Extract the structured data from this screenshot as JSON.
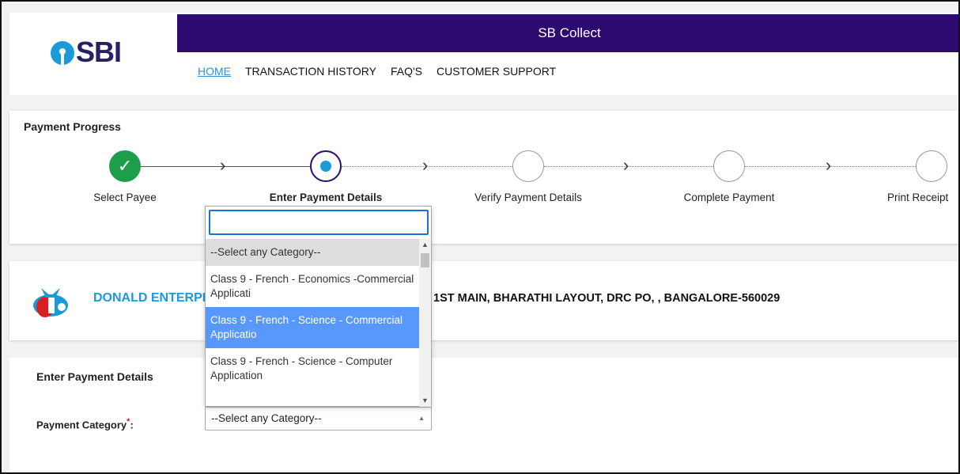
{
  "header": {
    "brand": "SBI",
    "banner_title": "SB Collect",
    "nav": [
      "HOME",
      "TRANSACTION HISTORY",
      "FAQ'S",
      "CUSTOMER SUPPORT"
    ]
  },
  "progress": {
    "title": "Payment Progress",
    "steps": [
      "Select Payee",
      "Enter Payment Details",
      "Verify Payment Details",
      "Complete Payment",
      "Print Receipt"
    ]
  },
  "merchant": {
    "name": "DONALD ENTERPRISES",
    "address": "1ST MAIN, BHARATHI LAYOUT, DRC PO, , BANGALORE-560029"
  },
  "details": {
    "title": "Enter Payment Details",
    "category_label": "Payment Category",
    "required_mark": "*",
    "colon": ":",
    "selected_value": "--Select any Category--"
  },
  "dropdown": {
    "search_value": "",
    "options": [
      "--Select any Category--",
      "Class 9 - French - Economics -Commercial Applicati",
      "Class 9 - French - Science - Commercial Applicatio",
      "Class 9 - French - Science - Computer Application"
    ]
  },
  "colors": {
    "brand_purple": "#2c0a6f",
    "accent_blue": "#1a9ad9",
    "success_green": "#1e9e4a",
    "highlight": "#5897fb"
  }
}
